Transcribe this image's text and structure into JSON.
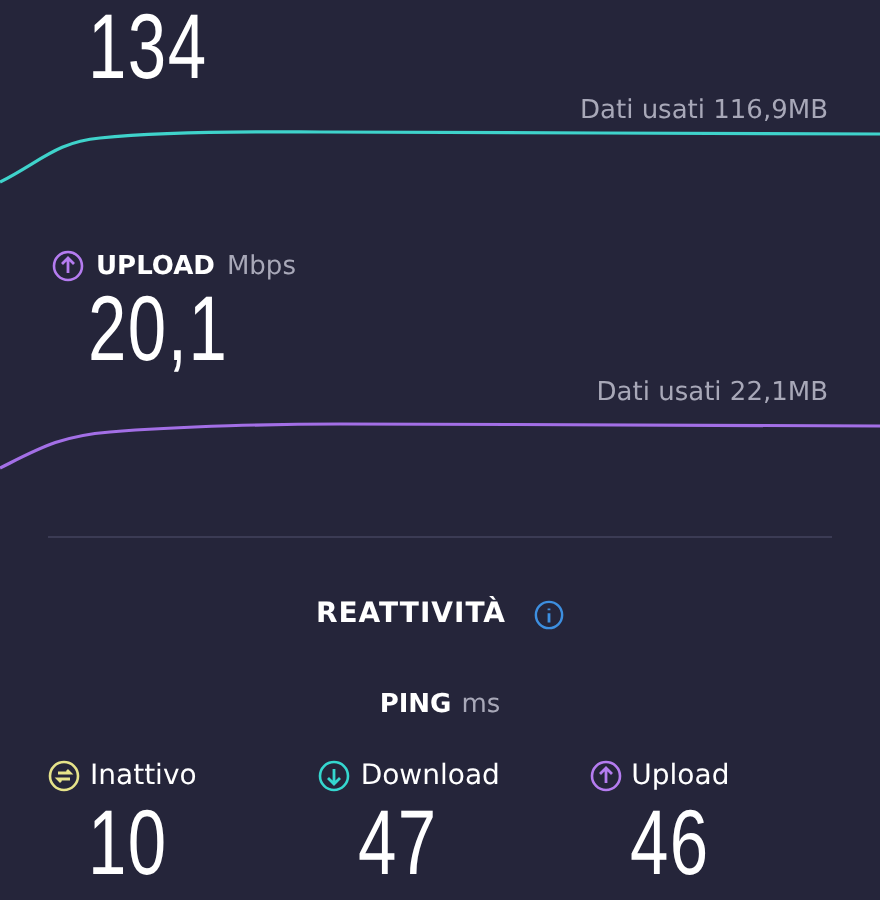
{
  "download": {
    "value": "134",
    "data_used": "Dati usati 116,9MB"
  },
  "upload": {
    "label": "UPLOAD",
    "unit": "Mbps",
    "value": "20,1",
    "data_used": "Dati usati 22,1MB"
  },
  "responsiveness": {
    "title": "REATTIVITÀ",
    "ping_label": "PING",
    "ping_unit": "ms",
    "items": [
      {
        "kind": "idle",
        "label": "Inattivo",
        "value": "10"
      },
      {
        "kind": "download",
        "label": "Download",
        "value": "47"
      },
      {
        "kind": "upload",
        "label": "Upload",
        "value": "46"
      }
    ]
  }
}
